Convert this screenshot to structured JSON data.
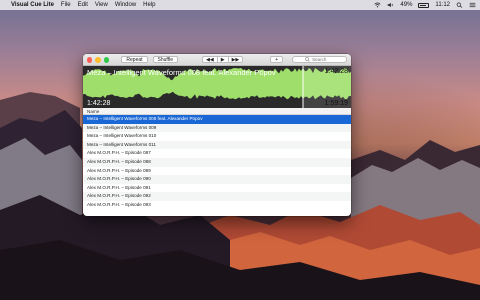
{
  "menubar": {
    "app_name": "Visual Cue Lite",
    "menus": [
      "File",
      "Edit",
      "View",
      "Window",
      "Help"
    ],
    "battery": "49%",
    "time": "11:12"
  },
  "toolbar": {
    "repeat_label": "Repeat",
    "shuffle_label": "Shuffle",
    "prev_label": "◀◀",
    "play_label": "▶",
    "next_label": "▶▶",
    "add_label": "+",
    "search_placeholder": "Search"
  },
  "player": {
    "track_title": "Meza – Intelligent Waveforms 008 feat. Alexander Popov",
    "time_total_top": "1:42:28",
    "time_elapsed": "1:42:28",
    "time_remaining": "1:59:19",
    "progress": 0.82,
    "waveform_color": "#9fde6a"
  },
  "playlist": {
    "column_header": "Name",
    "selected_index": 0,
    "rows": [
      "Meza – Intelligent Waveforms 008 feat. Alexander Popov",
      "Meza – Intelligent Waveforms 009",
      "Meza – Intelligent Waveforms 010",
      "Meza – Intelligent Waveforms 011",
      "Alex M.O.R.P.H. – Episode 087",
      "Alex M.O.R.P.H. – Episode 088",
      "Alex M.O.R.P.H. – Episode 089",
      "Alex M.O.R.P.H. – Episode 090",
      "Alex M.O.R.P.H. – Episode 091",
      "Alex M.O.R.P.H. – Episode 092",
      "Alex M.O.R.P.H. – Episode 093"
    ]
  }
}
